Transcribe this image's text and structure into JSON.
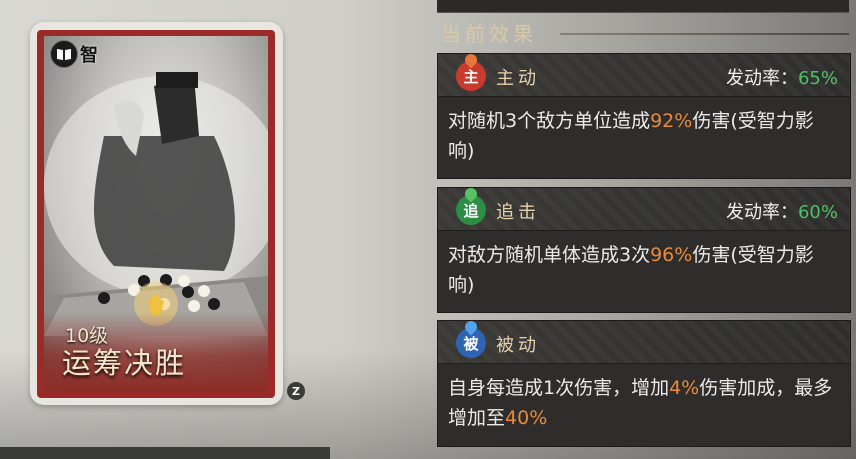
{
  "card": {
    "tag_text": "智",
    "level": "10级",
    "name": "运筹决胜",
    "badge": "Z"
  },
  "panel": {
    "title": "当前效果",
    "effects": [
      {
        "type": "主动",
        "icon_char": "主",
        "icon_color": "#c93b2c",
        "rate_label": "发动率：",
        "rate_value": "65%",
        "desc_a": "对随机3个敌方单位造成",
        "desc_highlight": "92%",
        "desc_b": "伤害(受智力影响)"
      },
      {
        "type": "追击",
        "icon_char": "追",
        "icon_color": "#2e8d45",
        "rate_label": "发动率：",
        "rate_value": "60%",
        "desc_a": "对敌方随机单体造成3次",
        "desc_highlight": "96%",
        "desc_b": "伤害(受智力影响)"
      },
      {
        "type": "被动",
        "icon_char": "被",
        "icon_color": "#2f64b4",
        "desc_a": "自身每造成1次伤害，增加",
        "desc_highlight": "4%",
        "desc_b": "伤害加成，最多增加至",
        "desc_highlight2": "40%"
      }
    ]
  },
  "colors": {
    "accent_orange": "#e98a3a",
    "rate_green": "#4fc067",
    "card_frame": "#9a2b28"
  }
}
